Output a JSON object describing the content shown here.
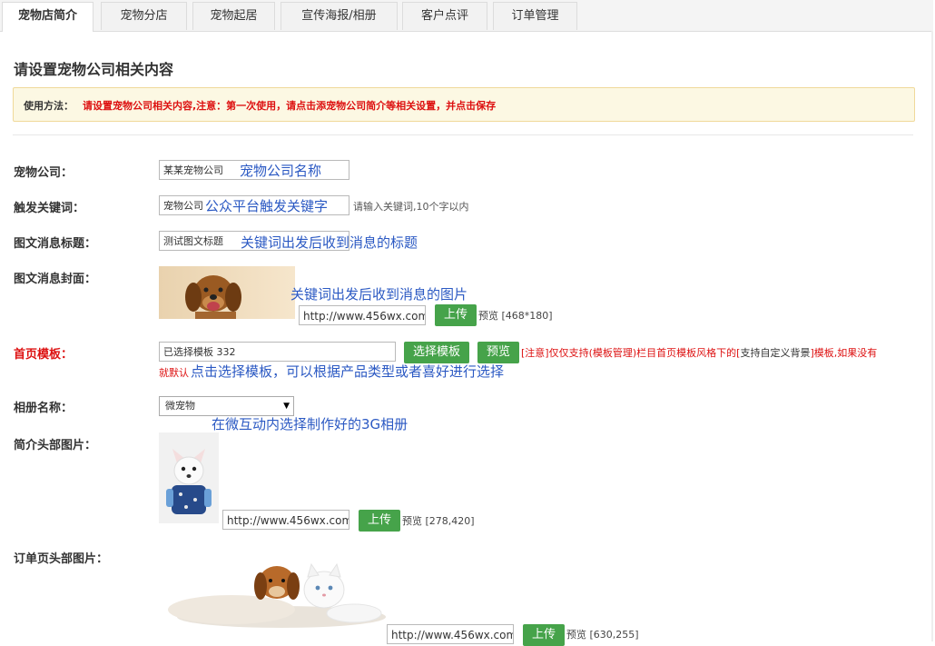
{
  "tabs": [
    {
      "label": "宠物店简介",
      "active": true
    },
    {
      "label": "宠物分店",
      "active": false
    },
    {
      "label": "宠物起居",
      "active": false
    },
    {
      "label": "宣传海报/相册",
      "active": false
    },
    {
      "label": "客户点评",
      "active": false
    },
    {
      "label": "订单管理",
      "active": false
    }
  ],
  "page_title": "请设置宠物公司相关内容",
  "notice": {
    "label": "使用方法：",
    "text": "请设置宠物公司相关内容,注意：第一次使用，请点击添宠物公司简介等相关设置，并点击保存"
  },
  "form": {
    "company": {
      "label": "宠物公司：",
      "value": "某某宠物公司",
      "annotation": "宠物公司名称"
    },
    "keyword": {
      "label": "触发关键词：",
      "value": "宠物公司",
      "annotation": "公众平台触发关键字",
      "hint": "请输入关键词,10个字以内"
    },
    "msg_title": {
      "label": "图文消息标题：",
      "value": "测试图文标题",
      "annotation": "关键词出发后收到消息的标题"
    },
    "msg_cover": {
      "label": "图文消息封面：",
      "annotation": "关键词出发后收到消息的图片",
      "url": "http://www.456wx.com,",
      "upload": "上传",
      "preview": "预览 [468*180]"
    },
    "home_template": {
      "label": "首页模板：",
      "value": "已选择模板 332",
      "select_btn": "选择模板",
      "preview_btn": "预览",
      "warning_pre": "[注意]仅仅支持(",
      "warning_link": "模板管理",
      "warning_mid": ")栏目首页模板风格下的[",
      "warning_dark": "支持自定义背景",
      "warning_post": "]模板,如果没有",
      "warning_line2": "就默认",
      "annotation": "点击选择模板，可以根据产品类型或者喜好进行选择"
    },
    "album": {
      "label": "相册名称：",
      "value": "微宠物",
      "annotation": "在微互动内选择制作好的3G相册"
    },
    "intro_header": {
      "label": "简介头部图片：",
      "url": "http://www.456wx.com,",
      "upload": "上传",
      "preview": "预览 [278,420]"
    },
    "order_header": {
      "label": "订单页头部图片：",
      "url": "http://www.456wx.com,",
      "upload": "上传",
      "preview": "预览 [630,255]"
    }
  },
  "colors": {
    "accent_green": "#46a34a",
    "warning_red": "#dd1111",
    "annotation_blue": "#2b59c3"
  }
}
